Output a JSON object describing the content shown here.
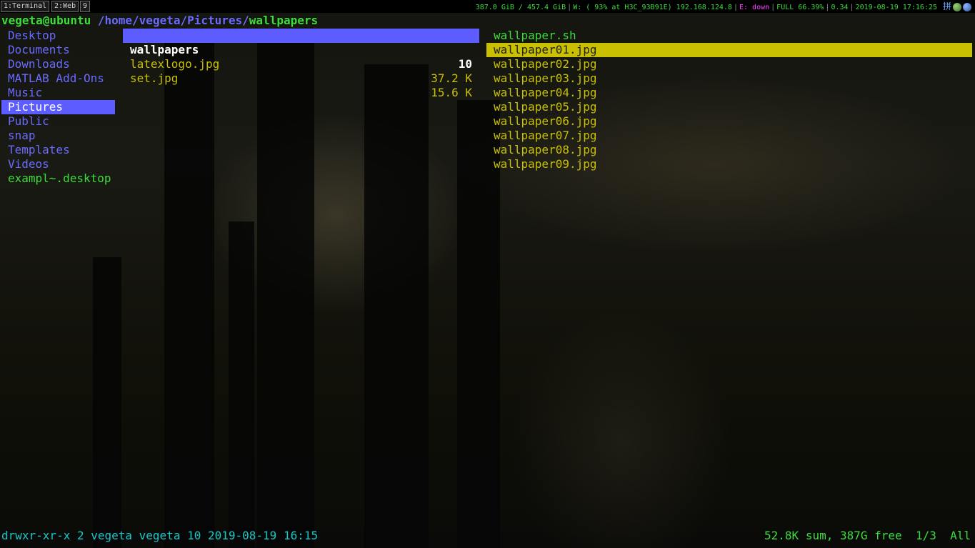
{
  "i3bar": {
    "workspaces": [
      {
        "label": "1:Terminal"
      },
      {
        "label": "2:Web"
      },
      {
        "label": "9"
      }
    ],
    "status": {
      "disk": "387.0 GiB / 457.4 GiB",
      "wifi": "W: ( 93% at H3C_93B91E) 192.168.124.8",
      "ethernet": "E: down",
      "battery": "FULL 66.39%",
      "load": "0.34",
      "datetime": "2019-08-19 17:16:25",
      "ime_glyph": "拼"
    }
  },
  "ranger": {
    "title_user_host": "vegeta@ubuntu",
    "title_path": "/home/vegeta/Pictures/",
    "title_current": "wallpapers",
    "parent_dirs": [
      {
        "name": "Desktop"
      },
      {
        "name": "Documents"
      },
      {
        "name": "Downloads"
      },
      {
        "name": "MATLAB Add-Ons"
      },
      {
        "name": "Music"
      },
      {
        "name": "Pictures",
        "selected": true
      },
      {
        "name": "Public"
      },
      {
        "name": "snap"
      },
      {
        "name": "Templates"
      },
      {
        "name": "Videos"
      },
      {
        "name": "exampl~.desktop",
        "executable": true
      }
    ],
    "current_dir": [
      {
        "name": "wallpapers",
        "size": "10",
        "selected": true
      },
      {
        "name": "latexlogo.jpg",
        "size": "37.2 K"
      },
      {
        "name": "set.jpg",
        "size": "15.6 K"
      }
    ],
    "preview": [
      {
        "name": "wallpaper.sh",
        "executable": true
      },
      {
        "name": "wallpaper01.jpg",
        "selected": true
      },
      {
        "name": "wallpaper02.jpg"
      },
      {
        "name": "wallpaper03.jpg"
      },
      {
        "name": "wallpaper04.jpg"
      },
      {
        "name": "wallpaper05.jpg"
      },
      {
        "name": "wallpaper06.jpg"
      },
      {
        "name": "wallpaper07.jpg"
      },
      {
        "name": "wallpaper08.jpg"
      },
      {
        "name": "wallpaper09.jpg"
      }
    ],
    "statusline": "drwxr-xr-x 2 vegeta vegeta 10 2019-08-19 16:15",
    "statusright": "52.8K sum, 387G free  1/3  All"
  },
  "colors": {
    "directory": "#6a6aff",
    "selection": "#5c5cff",
    "file": "#c8c000",
    "executable": "#3cdc3c",
    "statusline": "#18c8c8"
  }
}
